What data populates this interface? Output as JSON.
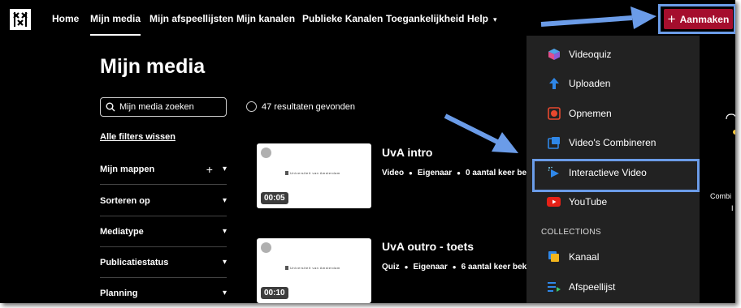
{
  "nav": {
    "logo_icon": "uva-logo-icon",
    "items": [
      "Home",
      "Mijn media",
      "Mijn afspeellijsten",
      "Mijn kanalen",
      "Publieke Kanalen",
      "Toegankelijkheid",
      "Help"
    ],
    "create_label": "Aanmaken"
  },
  "page": {
    "title": "Mijn media",
    "search_placeholder": "Mijn media zoeken",
    "results": "47 resultaten gevonden",
    "clear_filters": "Alle filters wissen"
  },
  "filters": [
    "Mijn mappen",
    "Sorteren op",
    "Mediatype",
    "Publicatiestatus",
    "Planning"
  ],
  "media": [
    {
      "title": "UvA intro",
      "duration": "00:05",
      "type": "Video",
      "role": "Eigenaar",
      "views": "0 aantal keer be",
      "thumb_text": "Universiteit van Amsterdam"
    },
    {
      "title": "UvA outro - toets",
      "duration": "00:10",
      "type": "Quiz",
      "role": "Eigenaar",
      "views": "6 aantal keer bek",
      "thumb_text": "Universiteit van Amsterdam"
    }
  ],
  "menu": {
    "items": [
      {
        "label": "Videoquiz",
        "icon": "cube-icon"
      },
      {
        "label": "Uploaden",
        "icon": "upload-arrow-icon"
      },
      {
        "label": "Opnemen",
        "icon": "record-icon"
      },
      {
        "label": "Video's Combineren",
        "icon": "combine-icon"
      },
      {
        "label": "Interactieve Video",
        "icon": "interactive-video-icon"
      },
      {
        "label": "YouTube",
        "icon": "youtube-icon"
      }
    ],
    "section": "COLLECTIONS",
    "collection_items": [
      {
        "label": "Kanaal",
        "icon": "channel-icon"
      },
      {
        "label": "Afspeellijst",
        "icon": "playlist-icon"
      }
    ]
  },
  "partial": {
    "line1": "Combi",
    "line2": "I"
  },
  "colors": {
    "accent": "#a50e2d",
    "highlight": "#6b9ce8",
    "menu_bg": "#222222"
  }
}
